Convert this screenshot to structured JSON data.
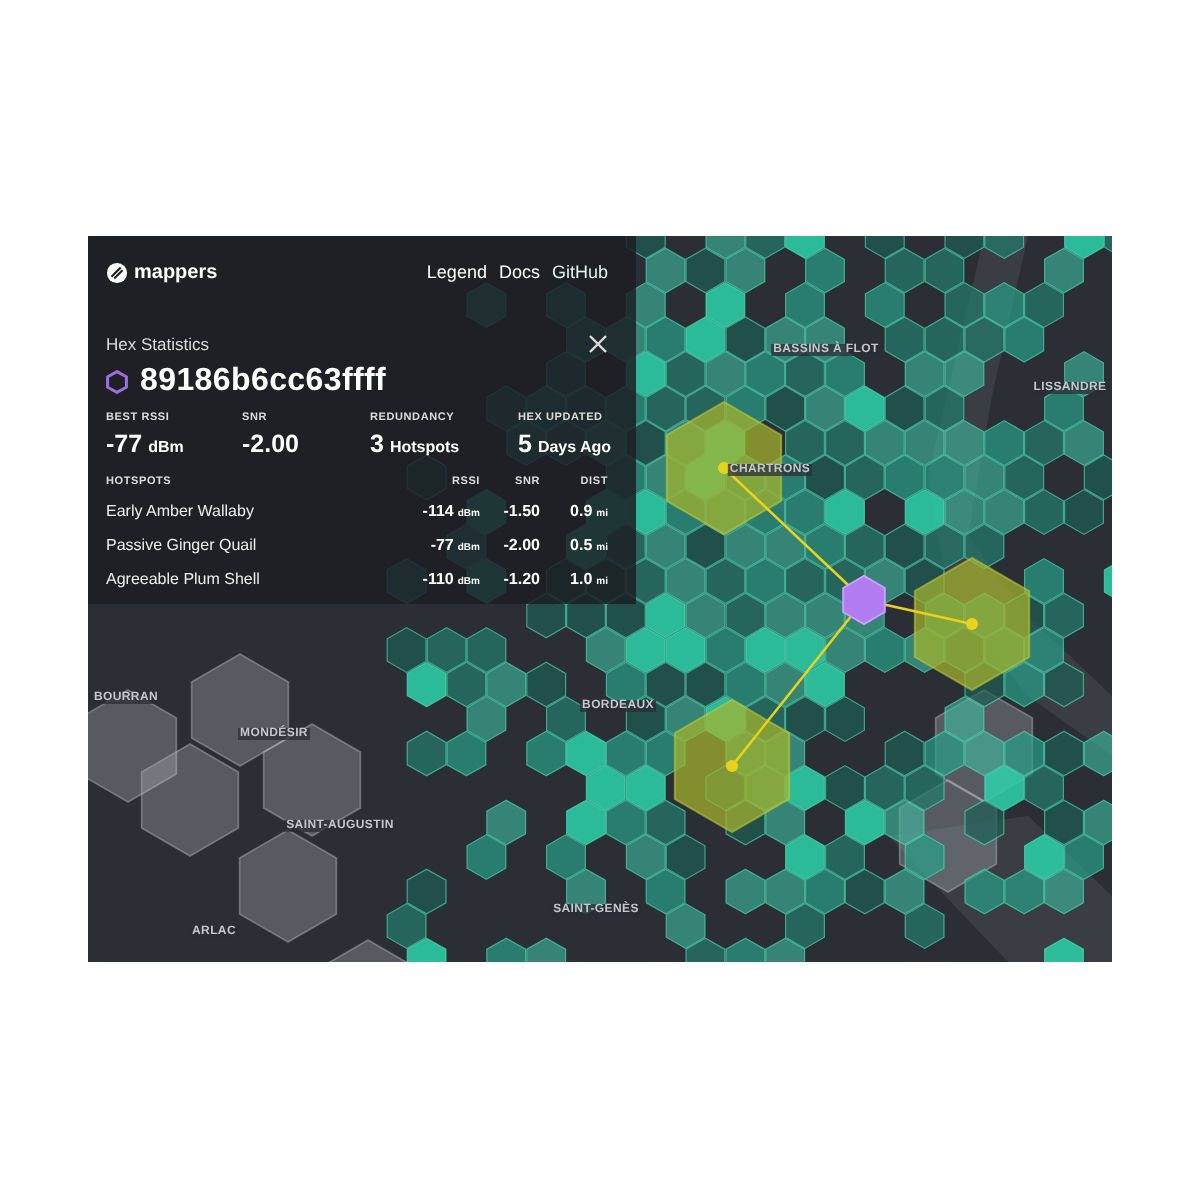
{
  "header": {
    "logo": "mappers",
    "links": [
      {
        "label": "Legend"
      },
      {
        "label": "Docs"
      },
      {
        "label": "GitHub"
      }
    ]
  },
  "panel": {
    "title": "Hex Statistics",
    "hex_id": "89186b6cc63ffff",
    "stats": [
      {
        "label": "BEST RSSI",
        "value": "-77",
        "unit": "dBm"
      },
      {
        "label": "SNR",
        "value": "-2.00"
      },
      {
        "label": "REDUNDANCY",
        "value": "3",
        "unit": "Hotspots"
      },
      {
        "label": "HEX UPDATED",
        "value": "5",
        "unit": "Days Ago"
      }
    ],
    "hotspots": {
      "columns": [
        "HOTSPOTS",
        "RSSI",
        "SNR",
        "DIST"
      ],
      "rows": [
        {
          "name": "Early Amber Wallaby",
          "rssi": "-114",
          "rssi_unit": "dBm",
          "snr": "-1.50",
          "dist": "0.9",
          "dist_unit": "mi"
        },
        {
          "name": "Passive Ginger Quail",
          "rssi": "-77",
          "rssi_unit": "dBm",
          "snr": "-2.00",
          "dist": "0.5",
          "dist_unit": "mi"
        },
        {
          "name": "Agreeable Plum Shell",
          "rssi": "-110",
          "rssi_unit": "dBm",
          "snr": "-1.20",
          "dist": "1.0",
          "dist_unit": "mi"
        }
      ]
    }
  },
  "map_labels": [
    "BASSINS À FLOT",
    "LISSANDRE",
    "CHARTRONS",
    "BOURRAN",
    "MONDÉSIR",
    "BORDEAUX",
    "SAINT-AUGUSTIN",
    "SAINT-GENÈS",
    "ARLAC"
  ]
}
